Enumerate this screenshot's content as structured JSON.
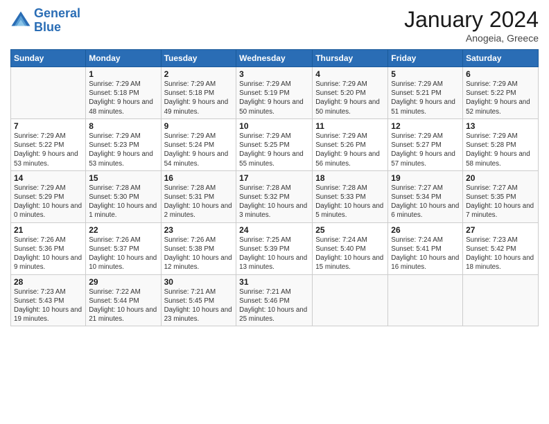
{
  "logo": {
    "line1": "General",
    "line2": "Blue"
  },
  "header": {
    "month": "January 2024",
    "location": "Anogeia, Greece"
  },
  "days_of_week": [
    "Sunday",
    "Monday",
    "Tuesday",
    "Wednesday",
    "Thursday",
    "Friday",
    "Saturday"
  ],
  "weeks": [
    [
      {
        "day": "",
        "sunrise": "",
        "sunset": "",
        "daylight": ""
      },
      {
        "day": "1",
        "sunrise": "Sunrise: 7:29 AM",
        "sunset": "Sunset: 5:18 PM",
        "daylight": "Daylight: 9 hours and 48 minutes."
      },
      {
        "day": "2",
        "sunrise": "Sunrise: 7:29 AM",
        "sunset": "Sunset: 5:18 PM",
        "daylight": "Daylight: 9 hours and 49 minutes."
      },
      {
        "day": "3",
        "sunrise": "Sunrise: 7:29 AM",
        "sunset": "Sunset: 5:19 PM",
        "daylight": "Daylight: 9 hours and 50 minutes."
      },
      {
        "day": "4",
        "sunrise": "Sunrise: 7:29 AM",
        "sunset": "Sunset: 5:20 PM",
        "daylight": "Daylight: 9 hours and 50 minutes."
      },
      {
        "day": "5",
        "sunrise": "Sunrise: 7:29 AM",
        "sunset": "Sunset: 5:21 PM",
        "daylight": "Daylight: 9 hours and 51 minutes."
      },
      {
        "day": "6",
        "sunrise": "Sunrise: 7:29 AM",
        "sunset": "Sunset: 5:22 PM",
        "daylight": "Daylight: 9 hours and 52 minutes."
      }
    ],
    [
      {
        "day": "7",
        "sunrise": "Sunrise: 7:29 AM",
        "sunset": "Sunset: 5:22 PM",
        "daylight": "Daylight: 9 hours and 53 minutes."
      },
      {
        "day": "8",
        "sunrise": "Sunrise: 7:29 AM",
        "sunset": "Sunset: 5:23 PM",
        "daylight": "Daylight: 9 hours and 53 minutes."
      },
      {
        "day": "9",
        "sunrise": "Sunrise: 7:29 AM",
        "sunset": "Sunset: 5:24 PM",
        "daylight": "Daylight: 9 hours and 54 minutes."
      },
      {
        "day": "10",
        "sunrise": "Sunrise: 7:29 AM",
        "sunset": "Sunset: 5:25 PM",
        "daylight": "Daylight: 9 hours and 55 minutes."
      },
      {
        "day": "11",
        "sunrise": "Sunrise: 7:29 AM",
        "sunset": "Sunset: 5:26 PM",
        "daylight": "Daylight: 9 hours and 56 minutes."
      },
      {
        "day": "12",
        "sunrise": "Sunrise: 7:29 AM",
        "sunset": "Sunset: 5:27 PM",
        "daylight": "Daylight: 9 hours and 57 minutes."
      },
      {
        "day": "13",
        "sunrise": "Sunrise: 7:29 AM",
        "sunset": "Sunset: 5:28 PM",
        "daylight": "Daylight: 9 hours and 58 minutes."
      }
    ],
    [
      {
        "day": "14",
        "sunrise": "Sunrise: 7:29 AM",
        "sunset": "Sunset: 5:29 PM",
        "daylight": "Daylight: 10 hours and 0 minutes."
      },
      {
        "day": "15",
        "sunrise": "Sunrise: 7:28 AM",
        "sunset": "Sunset: 5:30 PM",
        "daylight": "Daylight: 10 hours and 1 minute."
      },
      {
        "day": "16",
        "sunrise": "Sunrise: 7:28 AM",
        "sunset": "Sunset: 5:31 PM",
        "daylight": "Daylight: 10 hours and 2 minutes."
      },
      {
        "day": "17",
        "sunrise": "Sunrise: 7:28 AM",
        "sunset": "Sunset: 5:32 PM",
        "daylight": "Daylight: 10 hours and 3 minutes."
      },
      {
        "day": "18",
        "sunrise": "Sunrise: 7:28 AM",
        "sunset": "Sunset: 5:33 PM",
        "daylight": "Daylight: 10 hours and 5 minutes."
      },
      {
        "day": "19",
        "sunrise": "Sunrise: 7:27 AM",
        "sunset": "Sunset: 5:34 PM",
        "daylight": "Daylight: 10 hours and 6 minutes."
      },
      {
        "day": "20",
        "sunrise": "Sunrise: 7:27 AM",
        "sunset": "Sunset: 5:35 PM",
        "daylight": "Daylight: 10 hours and 7 minutes."
      }
    ],
    [
      {
        "day": "21",
        "sunrise": "Sunrise: 7:26 AM",
        "sunset": "Sunset: 5:36 PM",
        "daylight": "Daylight: 10 hours and 9 minutes."
      },
      {
        "day": "22",
        "sunrise": "Sunrise: 7:26 AM",
        "sunset": "Sunset: 5:37 PM",
        "daylight": "Daylight: 10 hours and 10 minutes."
      },
      {
        "day": "23",
        "sunrise": "Sunrise: 7:26 AM",
        "sunset": "Sunset: 5:38 PM",
        "daylight": "Daylight: 10 hours and 12 minutes."
      },
      {
        "day": "24",
        "sunrise": "Sunrise: 7:25 AM",
        "sunset": "Sunset: 5:39 PM",
        "daylight": "Daylight: 10 hours and 13 minutes."
      },
      {
        "day": "25",
        "sunrise": "Sunrise: 7:24 AM",
        "sunset": "Sunset: 5:40 PM",
        "daylight": "Daylight: 10 hours and 15 minutes."
      },
      {
        "day": "26",
        "sunrise": "Sunrise: 7:24 AM",
        "sunset": "Sunset: 5:41 PM",
        "daylight": "Daylight: 10 hours and 16 minutes."
      },
      {
        "day": "27",
        "sunrise": "Sunrise: 7:23 AM",
        "sunset": "Sunset: 5:42 PM",
        "daylight": "Daylight: 10 hours and 18 minutes."
      }
    ],
    [
      {
        "day": "28",
        "sunrise": "Sunrise: 7:23 AM",
        "sunset": "Sunset: 5:43 PM",
        "daylight": "Daylight: 10 hours and 19 minutes."
      },
      {
        "day": "29",
        "sunrise": "Sunrise: 7:22 AM",
        "sunset": "Sunset: 5:44 PM",
        "daylight": "Daylight: 10 hours and 21 minutes."
      },
      {
        "day": "30",
        "sunrise": "Sunrise: 7:21 AM",
        "sunset": "Sunset: 5:45 PM",
        "daylight": "Daylight: 10 hours and 23 minutes."
      },
      {
        "day": "31",
        "sunrise": "Sunrise: 7:21 AM",
        "sunset": "Sunset: 5:46 PM",
        "daylight": "Daylight: 10 hours and 25 minutes."
      },
      {
        "day": "",
        "sunrise": "",
        "sunset": "",
        "daylight": ""
      },
      {
        "day": "",
        "sunrise": "",
        "sunset": "",
        "daylight": ""
      },
      {
        "day": "",
        "sunrise": "",
        "sunset": "",
        "daylight": ""
      }
    ]
  ]
}
